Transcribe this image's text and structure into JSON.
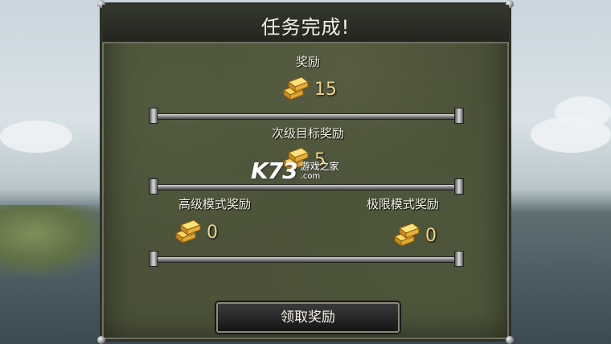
{
  "dialog": {
    "title": "任务完成!"
  },
  "rewards": {
    "base": {
      "label": "奖励",
      "amount": "15",
      "icon": "gold-bars-icon"
    },
    "secondary": {
      "label": "次级目标奖励",
      "amount": "5",
      "icon": "gold-bars-icon"
    },
    "advanced": {
      "label": "高级模式奖励",
      "amount": "0",
      "icon": "gold-bars-icon"
    },
    "extreme": {
      "label": "极限模式奖励",
      "amount": "0",
      "icon": "gold-bars-icon"
    }
  },
  "actions": {
    "claim_label": "领取奖励"
  },
  "watermark": {
    "brand": "K73",
    "subtitle": "游戏之家",
    "domain": ".com"
  },
  "colors": {
    "panel": "#4b5239",
    "titlebar": "#23251f",
    "gold_text": "#f0d48a",
    "text": "#f1ede0"
  }
}
